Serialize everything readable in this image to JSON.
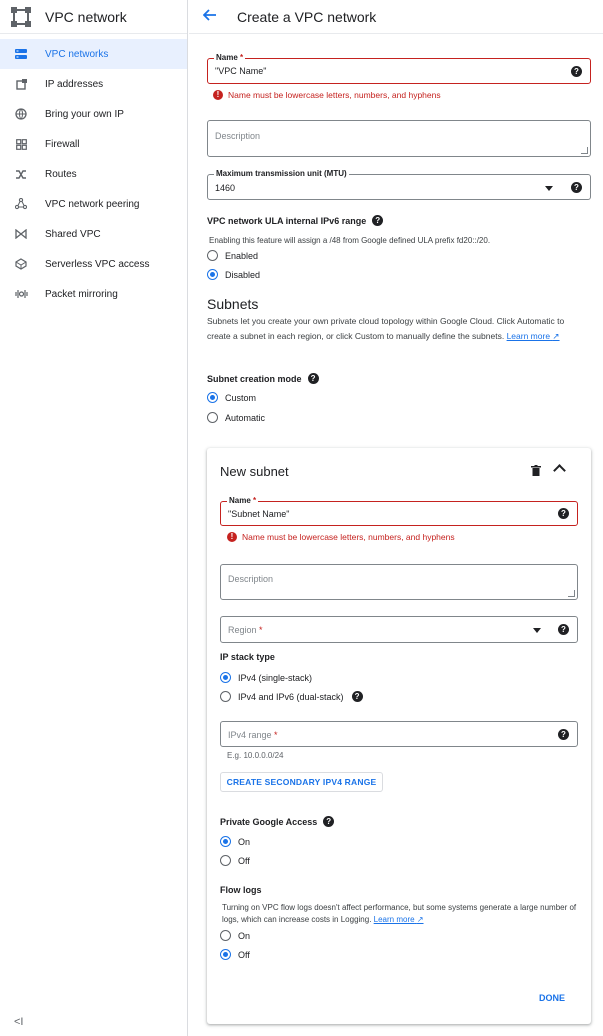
{
  "sidebar": {
    "title": "VPC network",
    "items": [
      {
        "label": "VPC networks",
        "icon": "vpc-networks-icon"
      },
      {
        "label": "IP addresses",
        "icon": "ip-addresses-icon"
      },
      {
        "label": "Bring your own IP",
        "icon": "globe-icon"
      },
      {
        "label": "Firewall",
        "icon": "firewall-icon"
      },
      {
        "label": "Routes",
        "icon": "routes-icon"
      },
      {
        "label": "VPC network peering",
        "icon": "peering-icon"
      },
      {
        "label": "Shared VPC",
        "icon": "shared-vpc-icon"
      },
      {
        "label": "Serverless VPC access",
        "icon": "serverless-icon"
      },
      {
        "label": "Packet mirroring",
        "icon": "packet-mirroring-icon"
      }
    ],
    "collapse_glyph": "<I"
  },
  "header": {
    "title": "Create a VPC network"
  },
  "form": {
    "name": {
      "label": "Name",
      "required": "*",
      "value": "\"VPC Name\"",
      "error": "Name must be lowercase letters, numbers, and hyphens"
    },
    "description": {
      "placeholder": "Description"
    },
    "mtu": {
      "label": "Maximum transmission unit (MTU)",
      "value": "1460"
    },
    "ula": {
      "label": "VPC network ULA internal IPv6 range",
      "help_text": "Enabling this feature will assign a /48 from Google defined ULA prefix fd20::/20.",
      "options": [
        "Enabled",
        "Disabled"
      ],
      "selected": "Disabled"
    },
    "subnets": {
      "heading": "Subnets",
      "text": "Subnets let you create your own private cloud topology within Google Cloud. Click Automatic to create a subnet in each region, or click Custom to manually define the subnets.",
      "learn_more": "Learn more"
    },
    "creation_mode": {
      "label": "Subnet creation mode",
      "options": [
        "Custom",
        "Automatic"
      ],
      "selected": "Custom"
    }
  },
  "subnet": {
    "title": "New subnet",
    "name": {
      "label": "Name",
      "required": "*",
      "value": "\"Subnet Name\"",
      "error": "Name must be lowercase letters, numbers, and hyphens"
    },
    "description": {
      "placeholder": "Description"
    },
    "region": {
      "placeholder": "Region",
      "required": "*"
    },
    "ip_stack": {
      "label": "IP stack type",
      "options": [
        "IPv4 (single-stack)",
        "IPv4 and IPv6 (dual-stack)"
      ],
      "selected": "IPv4 (single-stack)"
    },
    "ipv4_range": {
      "placeholder": "IPv4 range",
      "required": "*",
      "hint": "E.g. 10.0.0.0/24"
    },
    "secondary_button": "CREATE SECONDARY IPV4 RANGE",
    "private_access": {
      "label": "Private Google Access",
      "options": [
        "On",
        "Off"
      ],
      "selected": "On"
    },
    "flow_logs": {
      "label": "Flow logs",
      "text": "Turning on VPC flow logs doesn't affect performance, but some systems generate a large number of logs, which can increase costs in Logging.",
      "learn_more": "Learn more",
      "options": [
        "On",
        "Off"
      ],
      "selected": "Off"
    },
    "done": "DONE"
  },
  "colors": {
    "accent": "#1a73e8",
    "error": "#c5221f",
    "active_bg": "#e8f0fe"
  }
}
